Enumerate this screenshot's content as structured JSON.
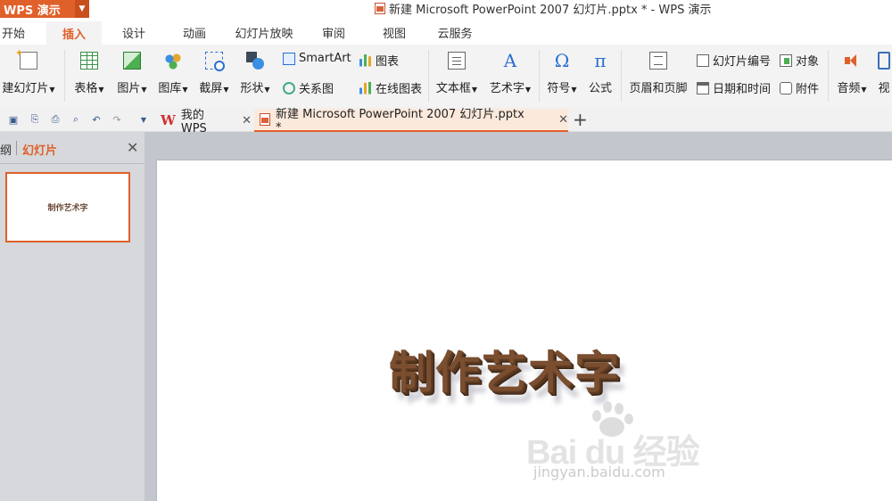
{
  "app": {
    "name": "WPS 演示",
    "window_title": "新建 Microsoft PowerPoint 2007 幻灯片.pptx * - WPS 演示"
  },
  "menu": {
    "tabs": [
      "开始",
      "插入",
      "设计",
      "动画",
      "幻灯片放映",
      "审阅",
      "视图",
      "云服务"
    ],
    "active": "插入"
  },
  "ribbon": {
    "new_slide": "建幻灯片",
    "table": "表格",
    "picture": "图片",
    "gallery": "图库",
    "screenshot": "截屏",
    "shape": "形状",
    "smartart": "SmartArt",
    "chart": "图表",
    "relation": "关系图",
    "online_chart": "在线图表",
    "textbox": "文本框",
    "wordart": "艺术字",
    "symbol": "符号",
    "formula": "公式",
    "header_footer": "页眉和页脚",
    "slide_number": "幻灯片编号",
    "object": "对象",
    "date_time": "日期和时间",
    "attachment": "附件",
    "audio": "音频",
    "video": "视"
  },
  "doc_tabs": {
    "my_wps": "我的WPS",
    "current": "新建 Microsoft PowerPoint 2007 幻灯片.pptx *"
  },
  "panel": {
    "outline_tab": "纲",
    "slides_tab": "幻灯片"
  },
  "slide": {
    "wordart_text": "制作艺术字",
    "thumbnail_text": "制作艺术字"
  },
  "watermark": {
    "brand": "Bai du 经验",
    "url": "jingyan.baidu.com"
  },
  "colors": {
    "accent": "#e0602a",
    "ribbon_bg": "#f3f3f3",
    "workspace_bg": "#c3c6cc",
    "wordart": "#7a4e2f"
  }
}
